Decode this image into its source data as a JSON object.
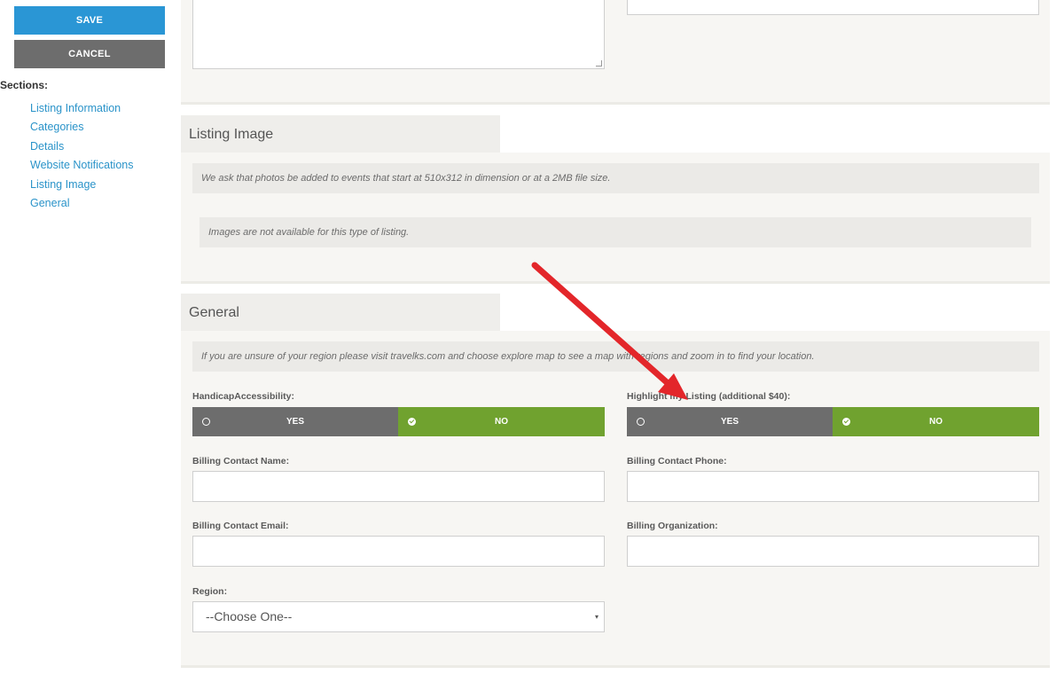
{
  "sidebar": {
    "save_label": "SAVE",
    "cancel_label": "CANCEL",
    "sections_label": "Sections:",
    "links": [
      "Listing Information",
      "Categories",
      "Details",
      "Website Notifications",
      "Listing Image",
      "General"
    ]
  },
  "listing_image": {
    "title": "Listing Image",
    "note": "We ask that photos be added to events that start at 510x312 in dimension or at a 2MB file size.",
    "unavailable": "Images are not available for this type of listing."
  },
  "general": {
    "title": "General",
    "region_note": "If you are unsure of your region please visit travelks.com and choose explore map to see a map with regions and zoom in to find your location.",
    "handicap": {
      "label": "HandicapAccessibility:",
      "yes": "YES",
      "no": "NO",
      "selected": "NO"
    },
    "highlight": {
      "label": "Highlight my Listing (additional $40):",
      "yes": "YES",
      "no": "NO",
      "selected": "NO"
    },
    "billing_name_label": "Billing Contact Name:",
    "billing_phone_label": "Billing Contact Phone:",
    "billing_email_label": "Billing Contact Email:",
    "billing_org_label": "Billing Organization:",
    "region_label": "Region:",
    "region_value": "--Choose One--",
    "dropdown_icon": "▾"
  },
  "colors": {
    "save": "#2a96d5",
    "cancel": "#6d6d6d",
    "selected_green": "#70a22f",
    "link": "#2a93c9",
    "annotation_arrow": "#e3262a"
  }
}
